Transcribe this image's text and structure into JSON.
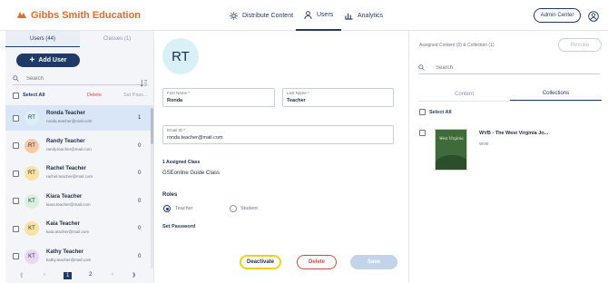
{
  "header": {
    "logo_text": "Gibbs Smith Education",
    "nav": [
      {
        "label": "Distribute Content",
        "icon": "distribute-icon",
        "active": false
      },
      {
        "label": "Users",
        "icon": "user-icon",
        "active": true
      },
      {
        "label": "Analytics",
        "icon": "bar-chart-icon",
        "active": false
      }
    ],
    "admin_button": "Admin Center",
    "account_icon": "account-circle-icon"
  },
  "left_panel": {
    "tabs": [
      {
        "label": "Users (44)",
        "active": true
      },
      {
        "label": "Classes (1)",
        "active": false
      }
    ],
    "add_user_label": "Add User",
    "search_placeholder": "Search",
    "select_all_label": "Select All",
    "delete_label": "Delete",
    "set_password_label": "Set Pass...",
    "users": [
      {
        "initials": "RT",
        "name": "Ronda Teacher",
        "email": "ronda.teacher@mail.com",
        "count": "1",
        "avatar_color": "#d9f1f6",
        "selected": true
      },
      {
        "initials": "RT",
        "name": "Randy Teacher",
        "email": "randy.teacher@mail.com",
        "count": "0",
        "avatar_color": "#f9c9a4",
        "selected": false
      },
      {
        "initials": "RT",
        "name": "Rachel Teacher",
        "email": "rachel.teacher@mail.com",
        "count": "0",
        "avatar_color": "#f8e3a0",
        "selected": false
      },
      {
        "initials": "KT",
        "name": "Kiara Teacher",
        "email": "kiara.teacher@mail.com",
        "count": "0",
        "avatar_color": "#d8f0dc",
        "selected": false
      },
      {
        "initials": "KT",
        "name": "Kaia Teacher",
        "email": "kaia.teacher@mail.com",
        "count": "0",
        "avatar_color": "#f8e3a0",
        "selected": false
      },
      {
        "initials": "KT",
        "name": "Kathy Teacher",
        "email": "kathy.teacher@mail.com",
        "count": "0",
        "avatar_color": "#e8d8f3",
        "selected": false
      }
    ],
    "pager": {
      "first": "⟪",
      "prev": "‹",
      "page1": "1",
      "page2": "2",
      "next": "›",
      "last": "⟫"
    }
  },
  "detail": {
    "avatar_initials": "RT",
    "first_name_label": "First Name *",
    "first_name": "Ronda",
    "last_name_label": "Last Name *",
    "last_name": "Teacher",
    "email_label": "Email ID *",
    "email": "ronda.teacher@mail.com",
    "assigned_class_label": "1 Assigned Class",
    "assigned_class": "GSEonline Guide Class",
    "roles_label": "Roles",
    "role_teacher": "Teacher",
    "role_student": "Student",
    "selected_role": "Teacher",
    "set_password": "Set Password",
    "deactivate": "Deactivate",
    "delete": "Delete",
    "save": "Save"
  },
  "assigned": {
    "title": "Assigned Content (0) & Collection (1)",
    "revoke": "Revoke",
    "search_placeholder": "Search",
    "tabs": [
      {
        "label": "Content",
        "active": false
      },
      {
        "label": "Collections",
        "active": true
      }
    ],
    "select_all": "Select All",
    "collections": [
      {
        "name": "WVB - The West Virginia Jo...",
        "code": "WVB",
        "cover_text": "West Virginia"
      }
    ]
  }
}
